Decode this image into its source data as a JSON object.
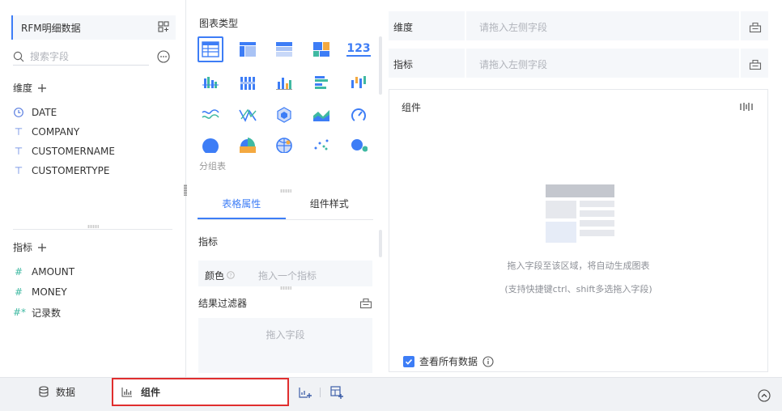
{
  "left_panel": {
    "dataset_name": "RFM明细数据",
    "search_placeholder": "搜索字段",
    "dimensions_title": "维度",
    "dimensions": [
      {
        "label": "DATE",
        "type_icon": "clock-icon"
      },
      {
        "label": "COMPANY",
        "type_icon": "text-type-icon"
      },
      {
        "label": "CUSTOMERNAME",
        "type_icon": "text-type-icon"
      },
      {
        "label": "CUSTOMERTYPE",
        "type_icon": "text-type-icon"
      }
    ],
    "measures_title": "指标",
    "measures": [
      {
        "label": "AMOUNT",
        "type_icon": "hash-icon"
      },
      {
        "label": "MONEY",
        "type_icon": "hash-icon"
      },
      {
        "label": "记录数",
        "type_icon": "hash-star-icon"
      }
    ]
  },
  "chart_panel": {
    "title": "图表类型",
    "chart_types": [
      "table-icon",
      "crosstab-icon",
      "detail-table-icon",
      "treemap-icon",
      "kpi-number-icon",
      "grouped-column-icon",
      "stacked-column-icon",
      "column-icon",
      "bar-icon",
      "range-column-icon",
      "area-line-icon",
      "radar-line-icon",
      "polygon-icon",
      "area-icon",
      "gauge-icon",
      "pie-icon",
      "rose-icon",
      "globe-icon",
      "scatter-icon",
      "bubble-icon"
    ],
    "kpi_text": "123",
    "group_label": "分组表",
    "tabs": [
      {
        "label": "表格属性",
        "active": true
      },
      {
        "label": "组件样式",
        "active": false
      }
    ],
    "measures_label": "指标",
    "color_label": "颜色",
    "color_hint": "拖入一个指标",
    "filter_label": "结果过滤器",
    "filter_hint": "拖入字段"
  },
  "config": {
    "dimension_label": "维度",
    "dimension_hint": "请拖入左侧字段",
    "measure_label": "指标",
    "measure_hint": "请拖入左侧字段"
  },
  "widget": {
    "title": "组件",
    "empty_line1": "拖入字段至该区域，将自动生成图表",
    "empty_line2": "(支持快捷键ctrl、shift多选拖入字段)",
    "view_all_label": "查看所有数据",
    "view_all_checked": true
  },
  "bottom_bar": {
    "data_tab": "数据",
    "widget_tab": "组件"
  },
  "colors": {
    "accent": "#3d7df6",
    "highlight_border": "#e02e2e",
    "panel_bg": "#f5f7fa"
  }
}
